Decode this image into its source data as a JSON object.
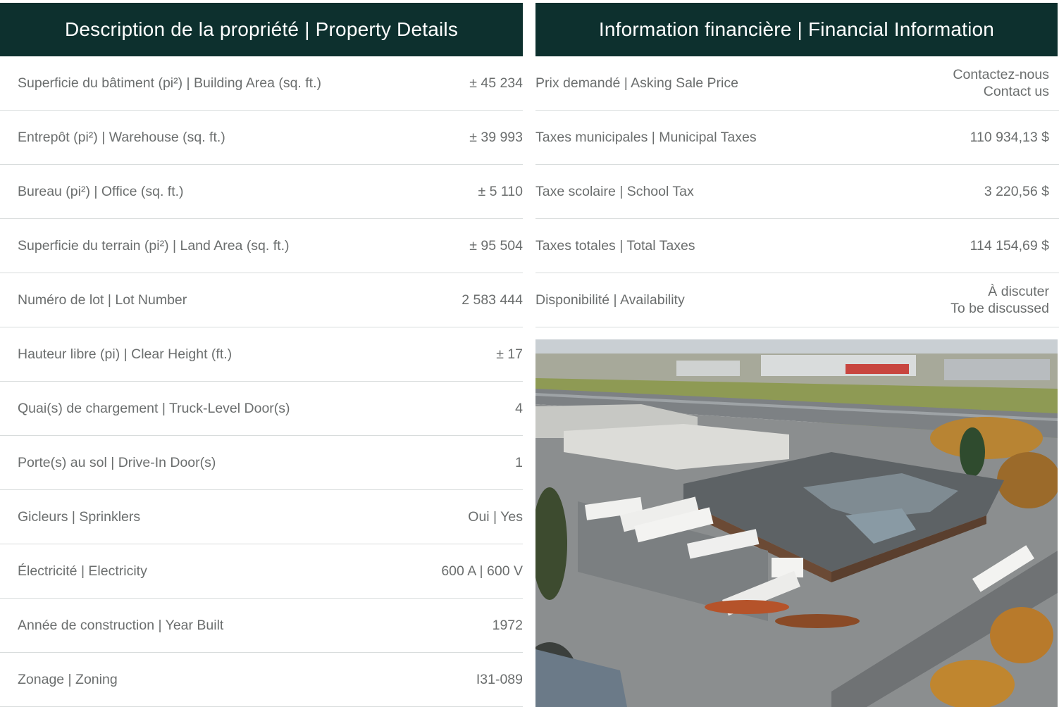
{
  "property": {
    "header": "Description de la propriété | Property Details",
    "rows": [
      {
        "label": "Superficie du bâtiment (pi²) | Building Area (sq. ft.)",
        "value": "± 45 234"
      },
      {
        "label": "Entrepôt (pi²) | Warehouse (sq. ft.)",
        "value": "± 39 993"
      },
      {
        "label": "Bureau (pi²) | Office (sq. ft.)",
        "value": "± 5 110"
      },
      {
        "label": "Superficie du terrain (pi²) | Land Area (sq. ft.)",
        "value": "± 95 504"
      },
      {
        "label": "Numéro de lot | Lot Number",
        "value": "2 583 444"
      },
      {
        "label": "Hauteur libre (pi) | Clear Height (ft.)",
        "value": "± 17"
      },
      {
        "label": "Quai(s) de chargement | Truck-Level Door(s)",
        "value": "4"
      },
      {
        "label": "Porte(s) au sol | Drive-In Door(s)",
        "value": "1"
      },
      {
        "label": "Gicleurs | Sprinklers",
        "value": "Oui | Yes"
      },
      {
        "label": "Électricité | Electricity",
        "value": "600 A | 600 V"
      },
      {
        "label": "Année de construction | Year Built",
        "value": "1972"
      },
      {
        "label": "Zonage | Zoning",
        "value": "I31-089"
      }
    ]
  },
  "financial": {
    "header": "Information financière | Financial Information",
    "rows": [
      {
        "label": "Prix demandé | Asking Sale Price",
        "value_fr": "Contactez-nous",
        "value_en": "Contact us"
      },
      {
        "label": "Taxes municipales | Municipal Taxes",
        "value": "110 934,13 $"
      },
      {
        "label": "Taxe scolaire | School Tax",
        "value": "3 220,56 $"
      },
      {
        "label": "Taxes totales | Total Taxes",
        "value": "114 154,69 $"
      },
      {
        "label": "Disponibilité | Availability",
        "value_fr": "À discuter",
        "value_en": "To be discussed"
      }
    ]
  },
  "colors": {
    "header_bg": "#0d302e",
    "header_text": "#ffffff",
    "body_text": "#6b6e6e",
    "divider": "#d8dcdc"
  }
}
